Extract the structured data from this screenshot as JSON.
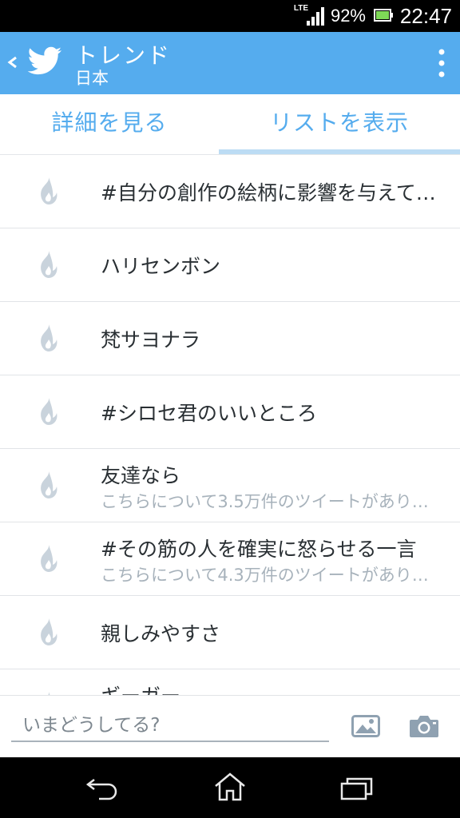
{
  "status_bar": {
    "network": "LTE",
    "battery_percent": "92%",
    "time": "22:47"
  },
  "app_bar": {
    "title": "トレンド",
    "subtitle": "日本"
  },
  "tabs": [
    {
      "label": "詳細を見る",
      "selected": false
    },
    {
      "label": "リストを表示",
      "selected": true
    }
  ],
  "trends": [
    {
      "name": "#自分の創作の絵柄に影響を与えて…",
      "description": ""
    },
    {
      "name": "ハリセンボン",
      "description": ""
    },
    {
      "name": "梵サヨナラ",
      "description": ""
    },
    {
      "name": "#シロセ君のいいところ",
      "description": ""
    },
    {
      "name": "友達なら",
      "description": "こちらについて3.5万件のツイートがあり…"
    },
    {
      "name": "#その筋の人を確実に怒らせる一言",
      "description": "こちらについて4.3万件のツイートがあり…"
    },
    {
      "name": "親しみやすさ",
      "description": ""
    },
    {
      "name": "ギーガー",
      "description": ""
    }
  ],
  "compose": {
    "placeholder": "いまどうしてる?"
  },
  "colors": {
    "accent": "#55acee",
    "tab_indicator": "#bcdcf4",
    "flame": "#c9d3dc",
    "text": "#292f33",
    "subtext": "#a7b2bb"
  }
}
